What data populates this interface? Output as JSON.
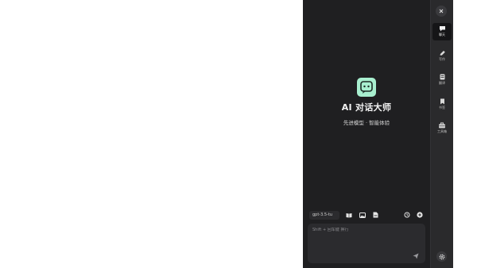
{
  "app": {
    "title": "AI 对话大师",
    "subtitle": "先进模型 · 智能体验",
    "logo_icon": "chat-bubble-icon",
    "logo_color": "#a8efcf"
  },
  "toolbar": {
    "model": "gpt-3.5-tu",
    "tools": [
      "book-icon",
      "image-icon",
      "file-icon",
      "history-icon",
      "add-icon"
    ]
  },
  "input": {
    "placeholder": "Shift + 回车键 换行",
    "value": ""
  },
  "rail": {
    "items": [
      {
        "label": "聊天",
        "icon": "chat-icon",
        "active": true
      },
      {
        "label": "写作",
        "icon": "pen-icon",
        "active": false
      },
      {
        "label": "翻译",
        "icon": "translate-icon",
        "active": false
      },
      {
        "label": "书签",
        "icon": "bookmark-icon",
        "active": false
      },
      {
        "label": "工具箱",
        "icon": "toolbox-icon",
        "active": false
      }
    ]
  },
  "colors": {
    "panel_bg": "#1f1f21",
    "rail_bg": "#2a2a2c",
    "input_bg": "#2b2b2e",
    "text": "#f2f2f2"
  }
}
